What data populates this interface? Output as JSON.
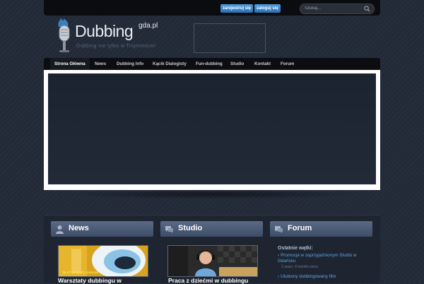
{
  "header": {
    "register_label": "zarejestruj się",
    "login_label": "zaloguj się",
    "search_placeholder": "Szukaj..."
  },
  "logo": {
    "title": "Dubbing",
    "superscript": "gda.pl",
    "tagline": "Dubbing nie tylko w Trójmieście!"
  },
  "nav": {
    "items": [
      "Strona Główna",
      "News",
      "Dubbing Info",
      "Kącik Dialogisty",
      "Fun-dubbing",
      "Studio",
      "Kontakt",
      "Forum"
    ],
    "active": "Strona Główna"
  },
  "columns": {
    "news": {
      "title": "News",
      "thumb_caption": "25-27.10.2013, Gdańsk",
      "article_title": "Warsztaty dubbingu w"
    },
    "studio": {
      "title": "Studio",
      "article_title": "Praca z dziećmi w dubbingu"
    },
    "forum": {
      "title": "Forum",
      "label": "Ostatnie wątki:",
      "topics": [
        {
          "title": "Promocja w zaprzyjaźnionym Studio w Gdańsku",
          "meta": "2 years, 4 months temu"
        },
        {
          "title": "Ulubiony dubbingowany film"
        }
      ]
    }
  },
  "colors": {
    "accent_blue": "#5aa6e6",
    "background": "#222a38",
    "header_bar": "#0a0c10"
  }
}
